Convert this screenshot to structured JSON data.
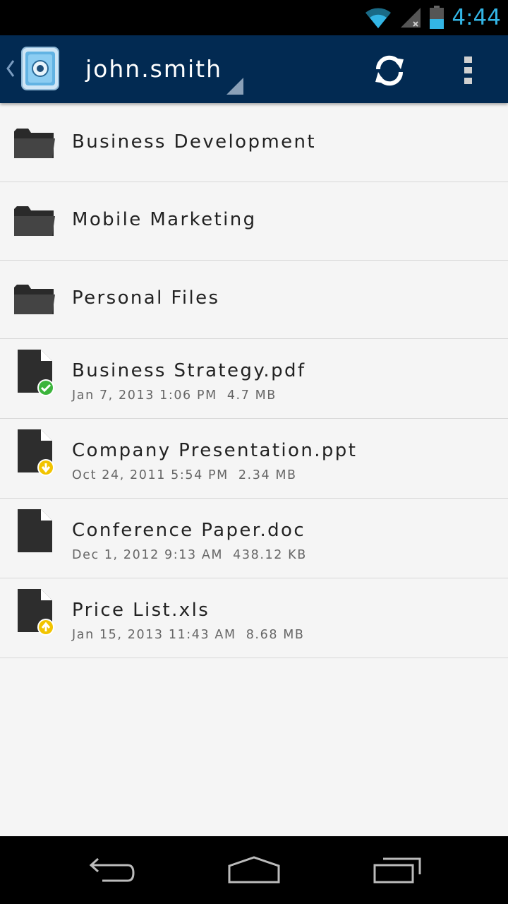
{
  "status_bar": {
    "time": "4:44",
    "icons": [
      "wifi-icon",
      "signal-icon",
      "battery-icon"
    ],
    "accent_color": "#33b5e5"
  },
  "action_bar": {
    "title": "john.smith",
    "background": "#022a52",
    "actions": [
      "refresh-icon",
      "overflow-menu-icon"
    ]
  },
  "folders": [
    {
      "name": "Business Development",
      "icon": "folder-icon"
    },
    {
      "name": "Mobile Marketing",
      "icon": "folder-icon"
    },
    {
      "name": "Personal Files",
      "icon": "folder-icon"
    }
  ],
  "files": [
    {
      "name": "Business Strategy.pdf",
      "date": "Jan 7, 2013 1:06 PM",
      "size": "4.7 MB",
      "status": "synced",
      "status_icon": "check-badge-icon",
      "status_color": "#3cb43c"
    },
    {
      "name": "Company Presentation.ppt",
      "date": "Oct 24, 2011 5:54 PM",
      "size": "2.34 MB",
      "status": "download",
      "status_icon": "download-badge-icon",
      "status_color": "#f2c400"
    },
    {
      "name": "Conference Paper.doc",
      "date": "Dec 1, 2012 9:13 AM",
      "size": "438.12 KB",
      "status": "none",
      "status_icon": "",
      "status_color": ""
    },
    {
      "name": "Price List.xls",
      "date": "Jan 15, 2013 11:43 AM",
      "size": "8.68 MB",
      "status": "upload",
      "status_icon": "upload-badge-icon",
      "status_color": "#f2c400"
    }
  ],
  "nav_bar": {
    "buttons": [
      "back-icon",
      "home-icon",
      "recent-apps-icon"
    ]
  }
}
